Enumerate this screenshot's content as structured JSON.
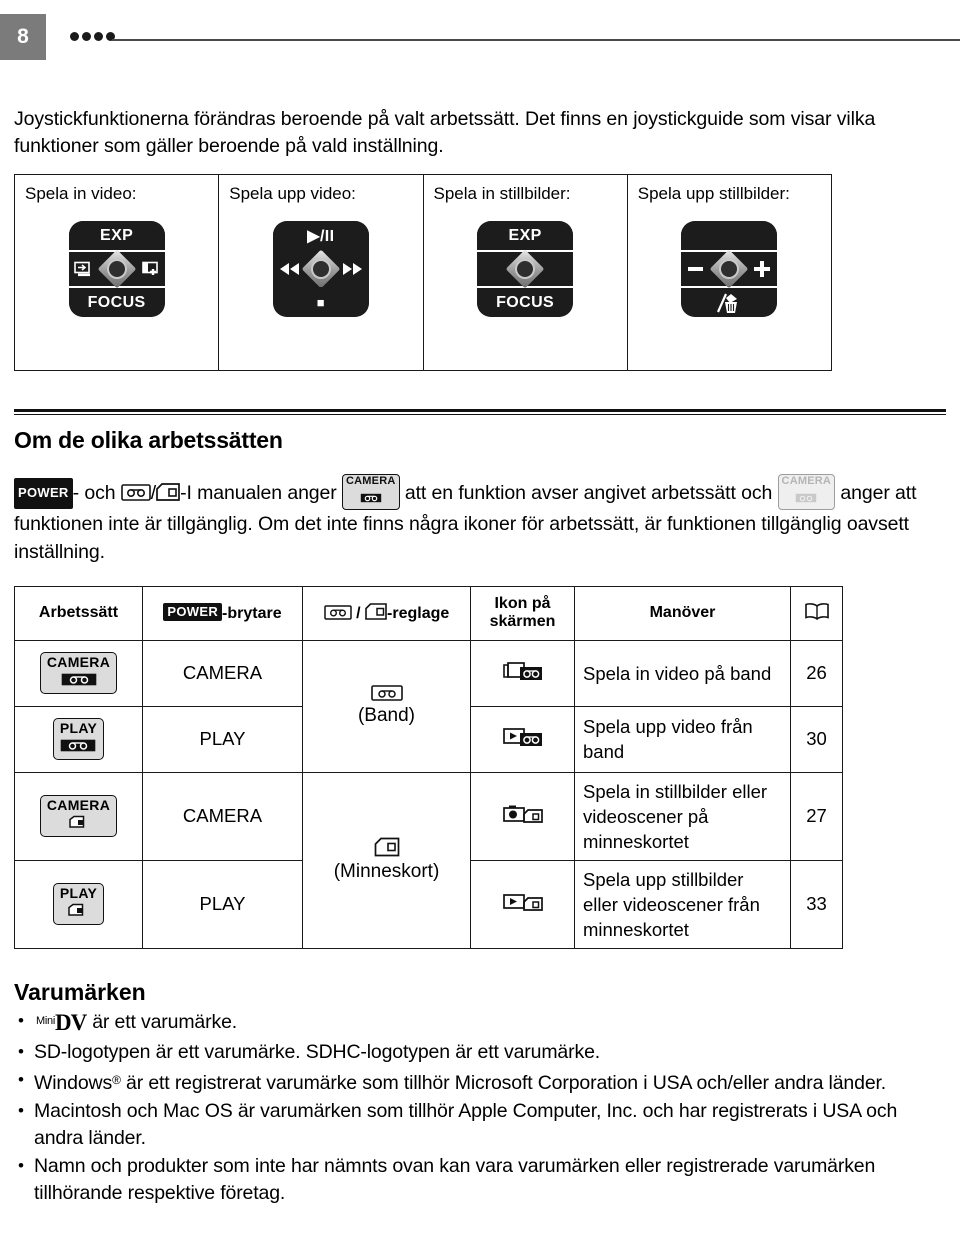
{
  "header": {
    "page_number": "8",
    "dot_count": 4
  },
  "intro": {
    "paragraph": "Joystickfunktionerna förändras beroende på valt arbetssätt. Det finns en joystickguide som visar vilka funktioner som gäller beroende på vald inställning."
  },
  "joystick_guide": {
    "cells": [
      {
        "caption": "Spela in video:",
        "pad": {
          "top_label": "EXP",
          "bottom_label": "FOCUS",
          "left_icon": "fade-out-icon",
          "right_icon": "backlight-plus-icon",
          "style": "banded"
        }
      },
      {
        "caption": "Spela upp video:",
        "pad": {
          "top_label": "▶/II",
          "bottom_label": "■",
          "left_icon": "rewind-icon",
          "right_icon": "fast-forward-icon",
          "style": "solid"
        }
      },
      {
        "caption": "Spela in stillbilder:",
        "pad": {
          "top_label": "EXP",
          "bottom_label": "FOCUS",
          "left_icon": "",
          "right_icon": "",
          "style": "banded"
        }
      },
      {
        "caption": "Spela upp stillbilder:",
        "pad": {
          "top_label": "",
          "bottom_label": "erase-icon",
          "left_icon": "minus-icon",
          "right_icon": "plus-icon",
          "style": "banded"
        }
      }
    ]
  },
  "modes_section": {
    "title": "Om de olika arbetssätten",
    "paragraph_parts": {
      "p1": "- och ",
      "p2": "-I manualen anger ",
      "p3": " att en funktion avser angivet arbetssätt och ",
      "p4": " anger att funktionen inte är tillgänglig. Om det inte finns några ikoner för arbetssätt, är funktionen tillgänglig oavsett inställning.",
      "power_badge": "POWER",
      "tape_icon": "tape-icon",
      "card_icon": "memory-card-icon",
      "camera_chip": "CAMERA",
      "camera_chip_dim": "CAMERA"
    }
  },
  "modes_table": {
    "headers": {
      "col1": "Arbetssätt",
      "col2_badge": "POWER",
      "col2_suffix": "-brytare",
      "col3_suffix": "-reglage",
      "col4_line1": "Ikon på",
      "col4_line2": "skärmen",
      "col5": "Manöver",
      "col6_icon": "book-icon"
    },
    "rows": [
      {
        "mode_chip_label": "CAMERA",
        "mode_chip_icon": "tape-icon",
        "power_switch": "CAMERA",
        "media_icon": "tape-icon",
        "media_label": "(Band)",
        "screen_icon": "camcorder-tape-icon",
        "operation": "Spela in video på band",
        "page": "26"
      },
      {
        "mode_chip_label": "PLAY",
        "mode_chip_icon": "tape-icon",
        "power_switch": "PLAY",
        "media_icon": "tape-icon",
        "media_label": "(Band)",
        "screen_icon": "play-tape-icon",
        "operation": "Spela upp video från band",
        "page": "30"
      },
      {
        "mode_chip_label": "CAMERA",
        "mode_chip_icon": "memory-card-icon",
        "power_switch": "CAMERA",
        "media_icon": "memory-card-icon",
        "media_label": "(Minneskort)",
        "screen_icon": "photo-card-icon",
        "operation": "Spela in stillbilder eller videoscener på minneskortet",
        "page": "27"
      },
      {
        "mode_chip_label": "PLAY",
        "mode_chip_icon": "memory-card-icon",
        "power_switch": "PLAY",
        "media_icon": "memory-card-icon",
        "media_label": "(Minneskort)",
        "screen_icon": "play-card-icon",
        "operation": "Spela upp stillbilder eller videoscener från minneskortet",
        "page": "33"
      }
    ]
  },
  "trademarks": {
    "title": "Varumärken",
    "items": [
      {
        "prefix_logo": "minidv-logo",
        "text": "är ett varumärke."
      },
      {
        "text": "SD-logotypen är ett varumärke. SDHC-logotypen är ett varumärke."
      },
      {
        "text_before_reg": "Windows",
        "text_after_reg": " är ett registrerat varumärke som tillhör Microsoft Corporation i USA och/eller andra länder."
      },
      {
        "text": "Macintosh och Mac OS är varumärken som tillhör Apple Computer, Inc. och har registrerats i USA och andra länder."
      },
      {
        "text": "Namn och produkter som inte har nämnts ovan kan vara varumärken eller registrerade varumärken tillhörande respektive företag."
      }
    ],
    "minidv": {
      "mini": "Mini",
      "dv": "DV"
    }
  }
}
